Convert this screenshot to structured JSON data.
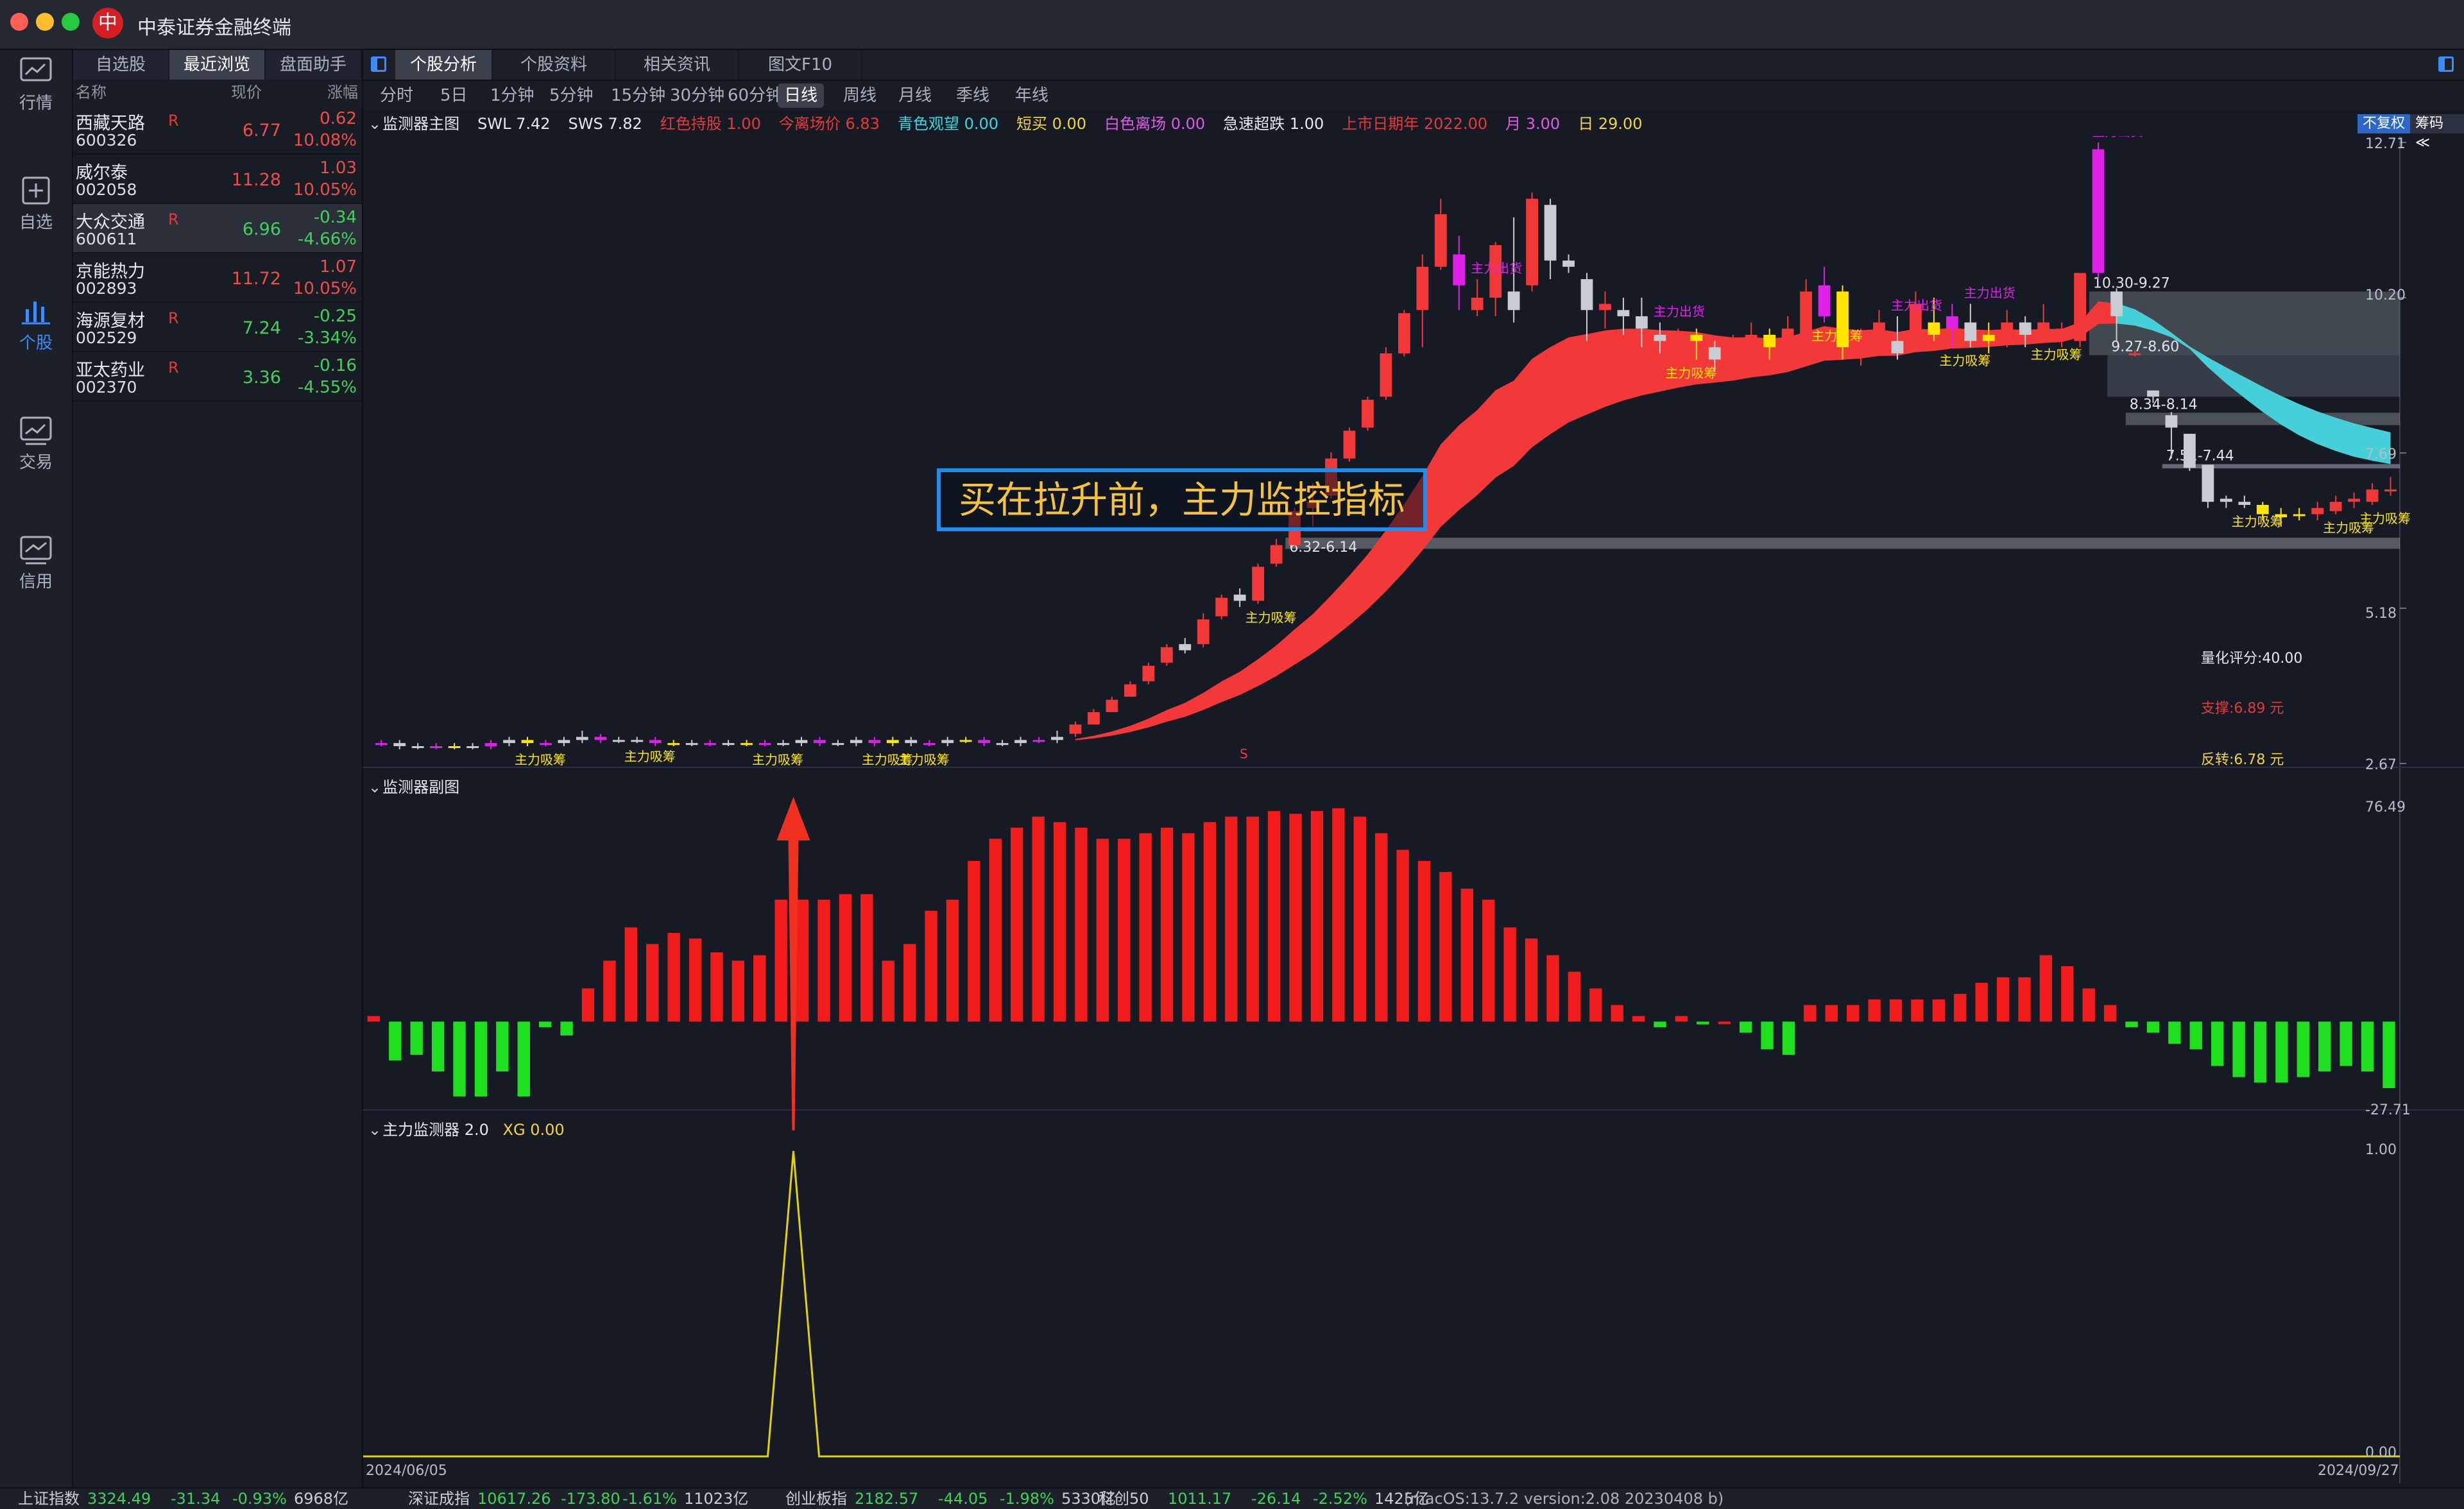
{
  "app": {
    "title": "中泰证券金融终端",
    "logo": "中"
  },
  "nav": [
    {
      "label": "行情",
      "icon": "chart-icon"
    },
    {
      "label": "自选",
      "icon": "add-watch-icon"
    },
    {
      "label": "个股",
      "icon": "bar-chart-icon",
      "active": true
    },
    {
      "label": "交易",
      "icon": "trade-icon"
    },
    {
      "label": "信用",
      "icon": "credit-icon"
    }
  ],
  "watch_tabs": [
    "自选股",
    "最近浏览",
    "盘面助手"
  ],
  "watch_headers": {
    "name": "名称",
    "price": "现价",
    "change": "涨幅"
  },
  "watch_rows": [
    {
      "name": "西藏天路",
      "code": "600326",
      "flag": "R",
      "price": "6.77",
      "change": "0.62",
      "pct": "10.08%",
      "dir": "up"
    },
    {
      "name": "威尔泰",
      "code": "002058",
      "flag": "",
      "price": "11.28",
      "change": "1.03",
      "pct": "10.05%",
      "dir": "up"
    },
    {
      "name": "大众交通",
      "code": "600611",
      "flag": "R",
      "price": "6.96",
      "change": "-0.34",
      "pct": "-4.66%",
      "dir": "dn"
    },
    {
      "name": "京能热力",
      "code": "002893",
      "flag": "",
      "price": "11.72",
      "change": "1.07",
      "pct": "10.05%",
      "dir": "up"
    },
    {
      "name": "海源复材",
      "code": "002529",
      "flag": "R",
      "price": "7.24",
      "change": "-0.25",
      "pct": "-3.34%",
      "dir": "dn"
    },
    {
      "name": "亚太药业",
      "code": "002370",
      "flag": "R",
      "price": "3.36",
      "change": "-0.16",
      "pct": "-4.55%",
      "dir": "dn"
    }
  ],
  "main_tabs": [
    "个股分析",
    "个股资料",
    "相关资讯",
    "图文F10"
  ],
  "periods": [
    "分时",
    "5日",
    "1分钟",
    "5分钟",
    "15分钟",
    "30分钟",
    "60分钟",
    "日线",
    "周线",
    "月线",
    "季线",
    "年线"
  ],
  "active_period": "日线",
  "main_indicator": {
    "name": "监测器主图",
    "items": [
      {
        "text": "SWL 7.42",
        "color": "#e6e8ee"
      },
      {
        "text": "SWS 7.82",
        "color": "#e6e8ee"
      },
      {
        "text": "红色持股 1.00",
        "color": "#e63a3a"
      },
      {
        "text": "今离场价 6.83",
        "color": "#e63a3a"
      },
      {
        "text": "青色观望 0.00",
        "color": "#3ad6e0"
      },
      {
        "text": "短买 0.00",
        "color": "#f5d33a"
      },
      {
        "text": "白色离场 0.00",
        "color": "#e05ae8"
      },
      {
        "text": "急速超跌 1.00",
        "color": "#e6e8ee"
      },
      {
        "text": "上市日期年 2022.00",
        "color": "#e63a3a"
      },
      {
        "text": "月 3.00",
        "color": "#e05ae8"
      },
      {
        "text": "日 29.00",
        "color": "#f5d33a"
      }
    ],
    "buttons": [
      "不复权",
      "筹码 ≪"
    ]
  },
  "sub_indicator": {
    "name": "监测器副图"
  },
  "third_indicator": {
    "name": "主力监测器 2.0",
    "items": [
      {
        "text": "XG 0.00",
        "color": "#f5d33a"
      }
    ]
  },
  "annotation": "买在拉升前，主力监控指标",
  "price_axis": [
    "12.71",
    "10.20",
    "7.69",
    "5.18",
    "2.67"
  ],
  "sub_axis": [
    "76.49",
    "-27.71"
  ],
  "third_axis": [
    "1.00",
    "0.00"
  ],
  "dates": {
    "start": "2024/06/05",
    "end": "2024/09/27"
  },
  "side_stats": [
    {
      "text": "量化评分:40.00",
      "color": "#e6e8ee"
    },
    {
      "text": "支撑:6.89 元",
      "color": "#e63a3a"
    },
    {
      "text": "反转:6.78 元",
      "color": "#f5d33a"
    }
  ],
  "zone_labels": [
    "10.30-9.27",
    "9.27-8.60",
    "8.34-8.14",
    "7.51-7.44",
    "6.32-6.14"
  ],
  "signal_labels": {
    "buy": "主力吸筹",
    "sell": "主力出货",
    "s": "S"
  },
  "status": [
    {
      "name": "上证指数",
      "value": "3324.49",
      "chg": "-31.34",
      "pct": "-0.93%",
      "amount": "6968亿"
    },
    {
      "name": "深证成指",
      "value": "10617.26",
      "chg": "-173.80",
      "pct": "-1.61%",
      "amount": "11023亿"
    },
    {
      "name": "创业板指",
      "value": "2182.57",
      "chg": "-44.05",
      "pct": "-1.98%",
      "amount": "5330亿"
    },
    {
      "name": "科创50",
      "value": "1011.17",
      "chg": "-26.14",
      "pct": "-2.52%",
      "amount": "1425亿"
    }
  ],
  "version": "(macOS:13.7.2 version:2.08 20230408 b)",
  "chart_data": {
    "type": "candlestick",
    "ylim": [
      2.67,
      12.71
    ],
    "candles": [
      [
        3.0,
        3.0,
        2.95,
        3.05
      ],
      [
        3.0,
        2.95,
        2.9,
        3.05
      ],
      [
        2.95,
        2.95,
        2.9,
        3.0
      ],
      [
        2.95,
        2.95,
        2.9,
        3.0
      ],
      [
        2.95,
        2.95,
        2.9,
        3.0
      ],
      [
        2.95,
        2.95,
        2.9,
        3.0
      ],
      [
        2.95,
        3.0,
        2.9,
        3.05
      ],
      [
        3.0,
        3.05,
        2.95,
        3.1
      ],
      [
        3.05,
        3.0,
        2.95,
        3.1
      ],
      [
        3.0,
        3.0,
        2.95,
        3.05
      ],
      [
        3.0,
        3.05,
        2.95,
        3.1
      ],
      [
        3.05,
        3.1,
        3.0,
        3.2
      ],
      [
        3.1,
        3.05,
        3.0,
        3.15
      ],
      [
        3.05,
        3.05,
        3.0,
        3.1
      ],
      [
        3.05,
        3.05,
        3.0,
        3.1
      ],
      [
        3.05,
        3.0,
        2.95,
        3.1
      ],
      [
        3.0,
        3.0,
        2.95,
        3.05
      ],
      [
        3.0,
        3.0,
        2.95,
        3.05
      ],
      [
        3.0,
        3.0,
        2.95,
        3.05
      ],
      [
        3.0,
        3.0,
        2.95,
        3.05
      ],
      [
        3.0,
        3.0,
        2.95,
        3.05
      ],
      [
        3.0,
        3.0,
        2.95,
        3.05
      ],
      [
        3.0,
        3.0,
        2.95,
        3.05
      ],
      [
        3.0,
        3.05,
        2.95,
        3.1
      ],
      [
        3.05,
        3.0,
        2.95,
        3.1
      ],
      [
        3.0,
        3.0,
        2.95,
        3.05
      ],
      [
        3.0,
        3.05,
        2.95,
        3.1
      ],
      [
        3.05,
        3.0,
        2.95,
        3.1
      ],
      [
        3.0,
        3.05,
        2.95,
        3.1
      ],
      [
        3.05,
        3.0,
        2.95,
        3.1
      ],
      [
        3.0,
        3.0,
        2.95,
        3.05
      ],
      [
        3.0,
        3.05,
        2.95,
        3.1
      ],
      [
        3.05,
        3.05,
        3.0,
        3.1
      ],
      [
        3.05,
        3.0,
        2.95,
        3.1
      ],
      [
        3.0,
        3.0,
        2.95,
        3.05
      ],
      [
        3.0,
        3.05,
        2.95,
        3.1
      ],
      [
        3.05,
        3.05,
        3.0,
        3.1
      ],
      [
        3.05,
        3.1,
        3.0,
        3.2
      ],
      [
        3.15,
        3.3,
        3.1,
        3.35
      ],
      [
        3.3,
        3.5,
        3.3,
        3.55
      ],
      [
        3.5,
        3.7,
        3.5,
        3.75
      ],
      [
        3.75,
        3.95,
        3.75,
        4.0
      ],
      [
        4.0,
        4.25,
        3.95,
        4.3
      ],
      [
        4.3,
        4.55,
        4.25,
        4.6
      ],
      [
        4.6,
        4.5,
        4.45,
        4.7
      ],
      [
        4.6,
        5.0,
        4.55,
        5.1
      ],
      [
        5.05,
        5.35,
        5.0,
        5.4
      ],
      [
        5.4,
        5.3,
        5.2,
        5.5
      ],
      [
        5.3,
        5.85,
        5.25,
        5.9
      ],
      [
        5.9,
        6.2,
        5.85,
        6.3
      ],
      [
        6.2,
        6.75,
        6.15,
        6.8
      ],
      [
        6.8,
        6.9,
        6.5,
        7.2
      ],
      [
        7.0,
        7.6,
        6.95,
        7.7
      ],
      [
        7.6,
        8.05,
        7.55,
        8.1
      ],
      [
        8.1,
        8.55,
        8.05,
        8.6
      ],
      [
        8.6,
        9.3,
        8.55,
        9.4
      ],
      [
        9.3,
        9.95,
        9.25,
        10.0
      ],
      [
        10.0,
        10.7,
        9.4,
        10.9
      ],
      [
        10.7,
        11.55,
        10.65,
        11.8
      ],
      [
        10.9,
        10.4,
        10.0,
        11.2
      ],
      [
        10.0,
        10.2,
        9.9,
        10.5
      ],
      [
        10.2,
        11.05,
        9.9,
        11.1
      ],
      [
        10.3,
        10.0,
        9.8,
        11.5
      ],
      [
        10.4,
        11.8,
        10.3,
        11.9
      ],
      [
        11.7,
        10.8,
        10.5,
        11.8
      ],
      [
        10.8,
        10.7,
        10.6,
        10.9
      ],
      [
        10.5,
        10.0,
        9.5,
        10.6
      ],
      [
        10.0,
        10.1,
        9.7,
        10.3
      ],
      [
        10.0,
        9.9,
        9.6,
        10.2
      ],
      [
        9.9,
        9.7,
        9.4,
        10.2
      ],
      [
        9.6,
        9.5,
        9.3,
        9.8
      ],
      [
        9.4,
        9.6,
        9.2,
        9.7
      ],
      [
        9.6,
        9.5,
        9.2,
        9.7
      ],
      [
        9.4,
        9.2,
        9.0,
        9.5
      ],
      [
        9.2,
        9.3,
        9.0,
        9.6
      ],
      [
        9.2,
        9.6,
        9.1,
        9.8
      ],
      [
        9.6,
        9.4,
        9.2,
        9.7
      ],
      [
        9.4,
        9.7,
        9.2,
        9.9
      ],
      [
        9.5,
        10.3,
        9.4,
        10.5
      ],
      [
        9.9,
        10.4,
        9.8,
        10.7
      ],
      [
        10.3,
        9.4,
        9.2,
        10.4
      ],
      [
        9.4,
        9.5,
        9.1,
        9.7
      ],
      [
        9.5,
        9.8,
        9.3,
        10.0
      ],
      [
        9.5,
        9.3,
        9.2,
        9.9
      ],
      [
        9.6,
        10.1,
        9.5,
        10.3
      ],
      [
        9.8,
        9.6,
        9.5,
        10.2
      ],
      [
        9.7,
        9.9,
        9.4,
        10.1
      ],
      [
        9.8,
        9.5,
        9.4,
        10.1
      ],
      [
        9.5,
        9.6,
        9.3,
        9.8
      ],
      [
        9.6,
        9.8,
        9.4,
        10.0
      ],
      [
        9.8,
        9.6,
        9.4,
        9.9
      ],
      [
        9.6,
        9.8,
        9.5,
        10.1
      ],
      [
        9.6,
        9.7,
        9.4,
        9.8
      ],
      [
        9.5,
        10.6,
        9.4,
        10.6
      ],
      [
        10.6,
        12.6,
        10.5,
        12.71
      ],
      [
        10.3,
        9.9,
        9.5,
        10.35
      ],
      [
        9.3,
        9.3,
        9.25,
        9.35
      ],
      [
        8.7,
        8.6,
        8.5,
        8.7
      ],
      [
        8.3,
        8.1,
        7.6,
        8.35
      ],
      [
        8.0,
        7.45,
        7.4,
        8.0
      ],
      [
        7.5,
        6.9,
        6.8,
        7.5
      ],
      [
        6.95,
        6.9,
        6.8,
        7.0
      ],
      [
        6.9,
        6.85,
        6.8,
        7.0
      ],
      [
        6.85,
        6.7,
        6.6,
        6.9
      ],
      [
        6.7,
        6.65,
        6.5,
        6.8
      ],
      [
        6.7,
        6.7,
        6.6,
        6.8
      ],
      [
        6.7,
        6.8,
        6.6,
        6.9
      ],
      [
        6.75,
        6.9,
        6.7,
        7.0
      ],
      [
        6.9,
        6.95,
        6.8,
        7.05
      ],
      [
        6.9,
        7.1,
        6.85,
        7.2
      ],
      [
        7.1,
        7.1,
        7.0,
        7.3
      ]
    ],
    "sub_values": [
      2,
      -14,
      -12,
      -18,
      -27,
      -27,
      -18,
      -27,
      -2,
      -5,
      12,
      22,
      34,
      28,
      32,
      30,
      25,
      22,
      24,
      44,
      44,
      44,
      46,
      46,
      22,
      28,
      40,
      44,
      58,
      66,
      70,
      74,
      72,
      70,
      66,
      66,
      68,
      70,
      68,
      72,
      74,
      74,
      76,
      75,
      76,
      77,
      74,
      68,
      62,
      58,
      54,
      48,
      44,
      34,
      30,
      24,
      18,
      12,
      6,
      2,
      -2,
      2,
      -1,
      0,
      -4,
      -10,
      -12,
      6,
      6,
      6,
      8,
      8,
      8,
      8,
      10,
      14,
      16,
      16,
      24,
      20,
      12,
      6,
      -2,
      -4,
      -8,
      -10,
      -16,
      -20,
      -22,
      -22,
      -20,
      -18,
      -16,
      -18,
      -24
    ],
    "sub_ylim": [
      -27.71,
      76.49
    ],
    "xg_peak_index": 22
  }
}
